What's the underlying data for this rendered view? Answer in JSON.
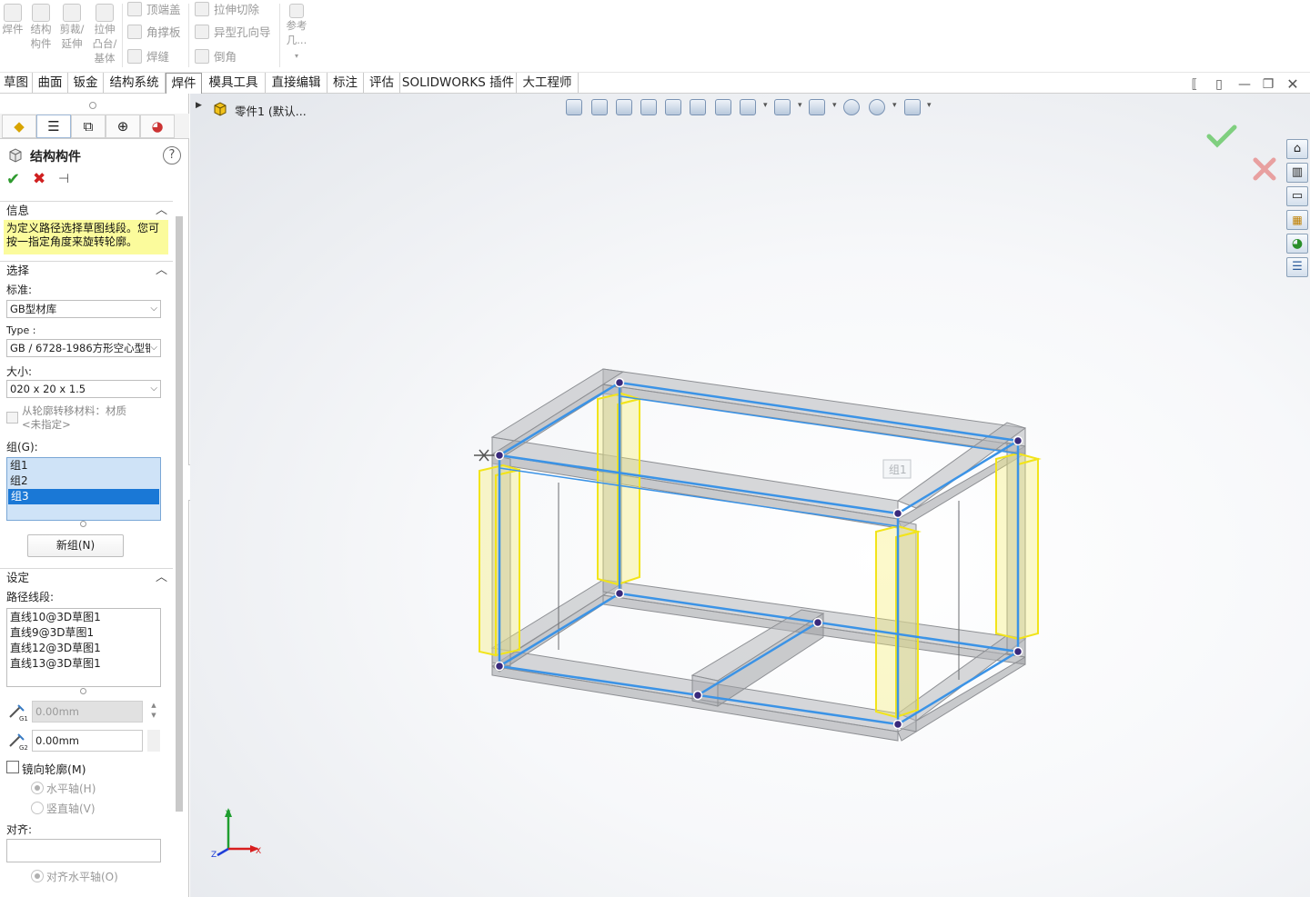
{
  "ribbon": {
    "big_buttons": [
      {
        "label": "焊件",
        "icon": "weldment-icon"
      },
      {
        "label": "结构构件",
        "icon": "structural-member-icon"
      },
      {
        "label": "剪裁/延伸",
        "icon": "trim-extend-icon"
      },
      {
        "label": "拉伸凸台/基体",
        "icon": "extrude-boss-icon"
      }
    ],
    "small_buttons": [
      {
        "label": "顶端盖",
        "icon": "end-cap-icon"
      },
      {
        "label": "角撑板",
        "icon": "gusset-icon"
      },
      {
        "label": "焊缝",
        "icon": "weld-bead-icon"
      },
      {
        "label": "拉伸切除",
        "icon": "extrude-cut-icon"
      },
      {
        "label": "异型孔向导",
        "icon": "hole-wizard-icon"
      },
      {
        "label": "倒角",
        "icon": "chamfer-icon"
      }
    ],
    "reference": {
      "label": "参考几...",
      "icon": "reference-geometry-icon"
    }
  },
  "tabs": [
    "草图",
    "曲面",
    "钣金",
    "结构系统",
    "焊件",
    "模具工具",
    "直接编辑",
    "标注",
    "评估",
    "SOLIDWORKS 插件",
    "大工程师"
  ],
  "active_tab": "焊件",
  "tree": {
    "part_label": "零件1 (默认..."
  },
  "panel": {
    "title": "结构构件",
    "help": "?",
    "info": {
      "header": "信息",
      "text": "为定义路径选择草图线段。您可按一指定角度来旋转轮廓。"
    },
    "selection": {
      "header": "选择",
      "standard_label": "标准:",
      "standard_value": "GB型材库",
      "type_label": "Type :",
      "type_value": "GB / 6728-1986方形空心型钢",
      "size_label": "大小:",
      "size_value": "020 x 20 x 1.5",
      "transfer_label": "从轮廓转移材料：材质",
      "transfer_sub": "<未指定>",
      "group_label": "组(G):",
      "groups": [
        "组1",
        "组2",
        "组3"
      ],
      "selected_group": "组3",
      "new_group_button": "新组(N)"
    },
    "settings": {
      "header": "设定",
      "path_label": "路径线段:",
      "paths": [
        "直线10@3D草图1",
        "直线9@3D草图1",
        "直线12@3D草图1",
        "直线13@3D草图1"
      ],
      "gap1_value": "0.00mm",
      "gap2_value": "0.00mm",
      "gap1_tag": "G1",
      "gap2_tag": "G2",
      "mirror_label": "镜向轮廓(M)",
      "horizontal_axis": "水平轴(H)",
      "vertical_axis": "竖直轴(V)",
      "align_label": "对齐:",
      "align_horizontal": "对齐水平轴(O)"
    }
  },
  "viewport": {
    "callout": "组1",
    "axes": {
      "x": "X",
      "y": "Y",
      "z": "Z"
    },
    "colors": {
      "frame": "#9a9ca0",
      "path": "#3b93e6",
      "highlight": "#f5ea1c",
      "accept": "#5cc25c",
      "cancel": "#e58888"
    }
  }
}
